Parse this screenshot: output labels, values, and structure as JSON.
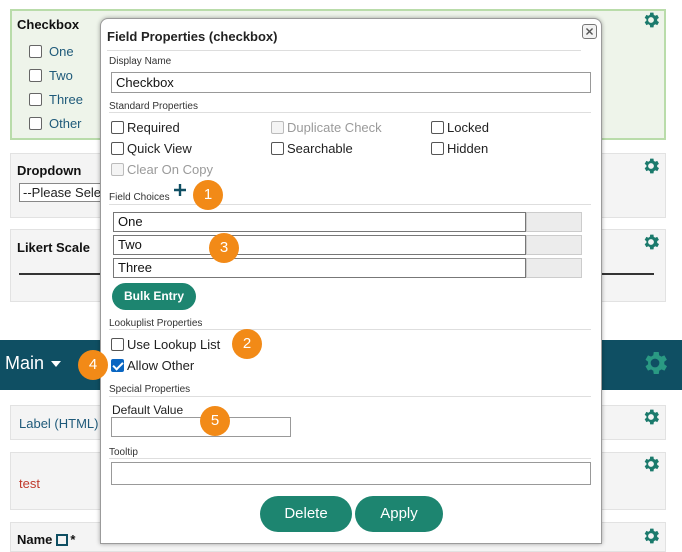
{
  "builder": {
    "checkbox_panel": {
      "title": "Checkbox",
      "options": [
        "One",
        "Two",
        "Three",
        "Other"
      ]
    },
    "dropdown_panel": {
      "title": "Dropdown",
      "select_value": "--Please Select--"
    },
    "likert_panel": {
      "title": "Likert Scale"
    },
    "main_section": {
      "label": "Main"
    },
    "label_html_panel": {
      "text": "Label (HTML)"
    },
    "test_panel": {
      "text": "test"
    },
    "name_panel": {
      "text": "Name",
      "required_mark": "*"
    }
  },
  "modal": {
    "title": "Field Properties (checkbox)",
    "display_name": {
      "label": "Display Name",
      "value": "Checkbox"
    },
    "standard": {
      "label": "Standard Properties",
      "required": "Required",
      "duplicate_check": "Duplicate Check",
      "locked": "Locked",
      "quick_view": "Quick View",
      "searchable": "Searchable",
      "hidden": "Hidden",
      "clear_on_copy": "Clear On Copy"
    },
    "field_choices": {
      "label": "Field Choices",
      "items": [
        "One",
        "Two",
        "Three"
      ],
      "bulk_entry": "Bulk Entry"
    },
    "lookuplist": {
      "label": "Lookuplist Properties",
      "use_lookup": "Use Lookup List",
      "allow_other": "Allow Other",
      "allow_other_checked": true
    },
    "special": {
      "label": "Special Properties",
      "default_value_label": "Default Value",
      "default_value": ""
    },
    "tooltip": {
      "label": "Tooltip",
      "value": ""
    },
    "buttons": {
      "delete": "Delete",
      "apply": "Apply"
    }
  },
  "badges": [
    "1",
    "2",
    "3",
    "4",
    "5"
  ],
  "colors": {
    "accent_green": "#1d8570",
    "main_bar": "#0f4f63",
    "badge_orange": "#f28a17",
    "gear": "#1b7a6c"
  },
  "icons": [
    "gear-icon",
    "close-icon",
    "plus-icon",
    "chevron-down-icon",
    "popout-icon"
  ]
}
